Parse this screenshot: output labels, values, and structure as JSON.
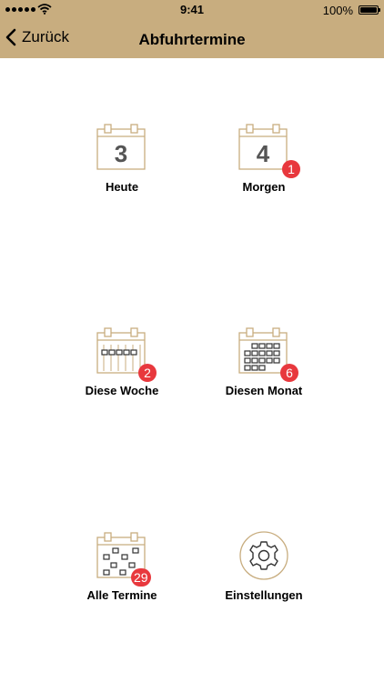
{
  "status_bar": {
    "time": "9:41",
    "battery": "100%"
  },
  "nav": {
    "back_label": "Zurück",
    "title": "Abfuhrtermine"
  },
  "tiles": [
    {
      "label": "Heute",
      "icon": "calendar-day-icon",
      "day": "3",
      "badge": ""
    },
    {
      "label": "Morgen",
      "icon": "calendar-day-icon",
      "day": "4",
      "badge": "1"
    },
    {
      "label": "Diese Woche",
      "icon": "calendar-week-icon",
      "badge": "2"
    },
    {
      "label": "Diesen Monat",
      "icon": "calendar-month-icon",
      "badge": "6"
    },
    {
      "label": "Alle Termine",
      "icon": "calendar-all-icon",
      "badge": "29"
    },
    {
      "label": "Einstellungen",
      "icon": "gear-icon"
    }
  ],
  "colors": {
    "accent": "#c8ad7f",
    "badge": "#e8383d",
    "icon_stroke": "#c8ad7f"
  }
}
